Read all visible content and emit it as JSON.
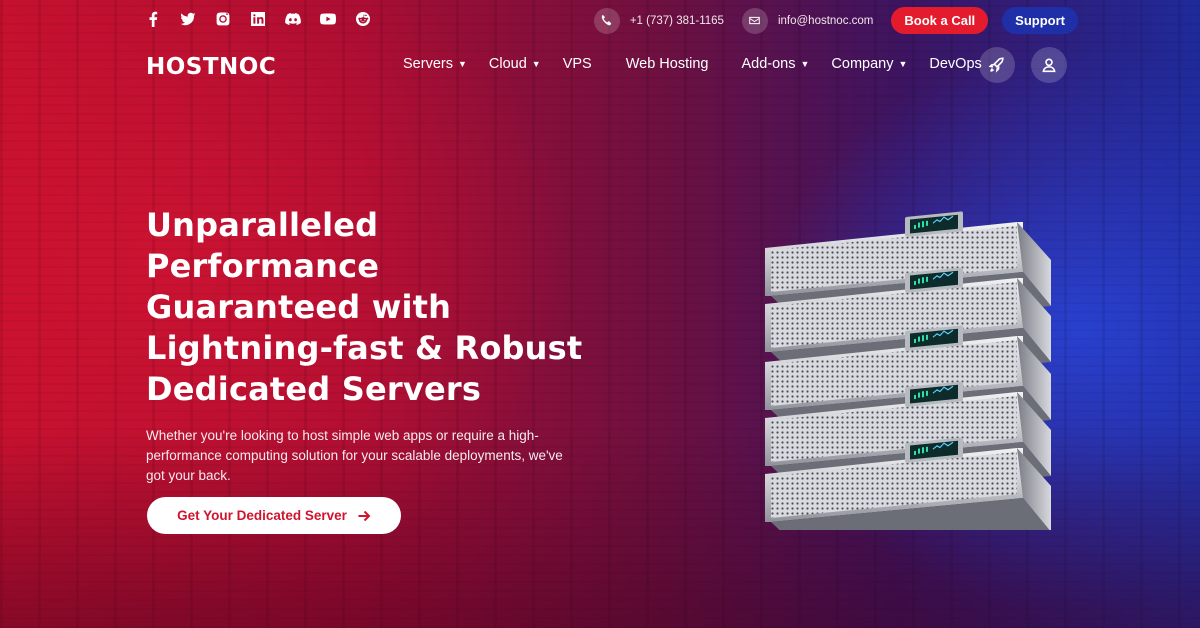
{
  "topbar": {
    "social_icons": [
      "facebook-icon",
      "twitter-icon",
      "instagram-icon",
      "linkedin-icon",
      "discord-icon",
      "youtube-icon",
      "reddit-icon"
    ],
    "phone": "+1 (737) 381-1165",
    "email": "info@hostnoc.com",
    "book_call_label": "Book a Call",
    "support_label": "Support"
  },
  "header": {
    "logo": "HOSTNOC",
    "nav": [
      {
        "label": "Servers",
        "has_dropdown": true
      },
      {
        "label": "Cloud",
        "has_dropdown": true
      },
      {
        "label": "VPS",
        "has_dropdown": false
      },
      {
        "label": "Web Hosting",
        "has_dropdown": false
      },
      {
        "label": "Add-ons",
        "has_dropdown": true
      },
      {
        "label": "Company",
        "has_dropdown": true
      },
      {
        "label": "DevOps",
        "has_dropdown": false
      }
    ],
    "right_icons": [
      "rocket-icon",
      "user-icon"
    ]
  },
  "hero": {
    "headline_lines": [
      "Unparalleled",
      "Performance",
      "Guaranteed with",
      "Lightning-fast & Robust",
      "Dedicated Servers"
    ],
    "subtext": "Whether you're looking to host simple web apps or require a high-performance computing solution for your scalable deployments, we've got your back.",
    "cta_label": "Get Your Dedicated Server"
  },
  "colors": {
    "accent_red": "#e41b2d",
    "support_blue": "#1f2fa8",
    "cta_text": "#d0142e"
  }
}
